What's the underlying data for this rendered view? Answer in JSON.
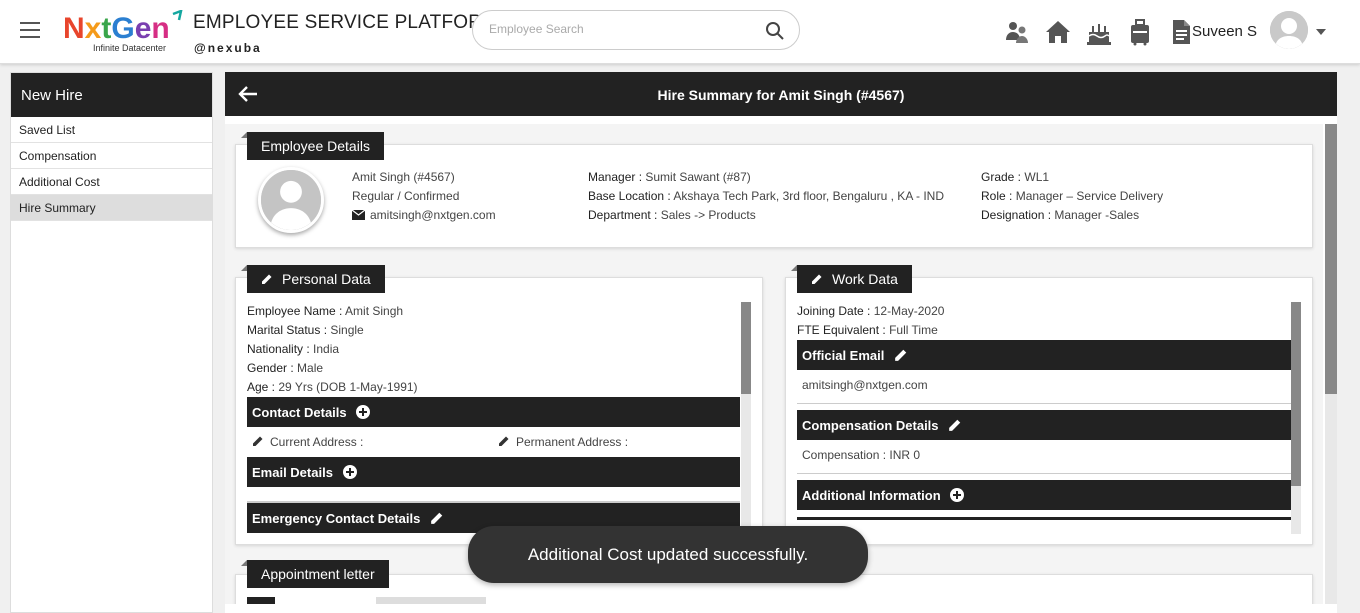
{
  "header": {
    "logo_text": "NxtGen",
    "logo_sub": "Infinite Datacenter",
    "app_title": "EMPLOYEE SERVICE PLATFORM",
    "brand": "@nexuba",
    "search_placeholder": "Employee Search",
    "user_name": "Suveen S",
    "icons": [
      "team-icon",
      "home-icon",
      "birthday-cake-icon",
      "luggage-icon",
      "document-icon"
    ]
  },
  "sidebar": {
    "title": "New Hire",
    "items": [
      {
        "label": "Saved List"
      },
      {
        "label": "Compensation"
      },
      {
        "label": "Additional Cost"
      },
      {
        "label": "Hire Summary",
        "active": true
      }
    ]
  },
  "page": {
    "title": "Hire Summary for Amit Singh (#4567)"
  },
  "employee_details": {
    "tag": "Employee Details",
    "name_id": "Amit Singh (#4567)",
    "status": "Regular / Confirmed",
    "email": "amitsingh@nxtgen.com",
    "manager_label": "Manager :",
    "manager": "Sumit Sawant (#87)",
    "base_location_label": "Base Location :",
    "base_location": "Akshaya Tech Park, 3rd floor, Bengaluru , KA - IND",
    "department_label": "Department :",
    "department": "Sales -> Products",
    "grade_label": "Grade :",
    "grade": "WL1",
    "role_label": "Role :",
    "role": "Manager – Service Delivery",
    "designation_label": "Designation :",
    "designation": "Manager -Sales"
  },
  "personal_data": {
    "tag": "Personal Data",
    "employee_name_label": "Employee Name :",
    "employee_name": "Amit Singh",
    "marital_status_label": "Marital Status :",
    "marital_status": "Single",
    "nationality_label": "Nationality :",
    "nationality": "India",
    "gender_label": "Gender :",
    "gender": "Male",
    "age_label": "Age :",
    "age": "29 Yrs (DOB 1-May-1991)",
    "contact_details": "Contact Details",
    "current_address": "Current Address :",
    "permanent_address": "Permanent Address :",
    "email_details": "Email Details",
    "emergency_contact": "Emergency Contact Details"
  },
  "work_data": {
    "tag": "Work Data",
    "joining_date_label": "Joining Date :",
    "joining_date": "12-May-2020",
    "fte_label": "FTE Equivalent :",
    "fte": "Full Time",
    "official_email": "Official Email",
    "official_email_value": "amitsingh@nxtgen.com",
    "compensation_details": "Compensation Details",
    "compensation_value": "Compensation : INR 0",
    "additional_information": "Additional Information"
  },
  "appointment": {
    "tag": "Appointment letter"
  },
  "toast": {
    "message": "Additional Cost updated successfully."
  },
  "colors": {
    "header_bar": "#222222",
    "toast_bg": "#333333",
    "active_item": "#dddddd"
  }
}
